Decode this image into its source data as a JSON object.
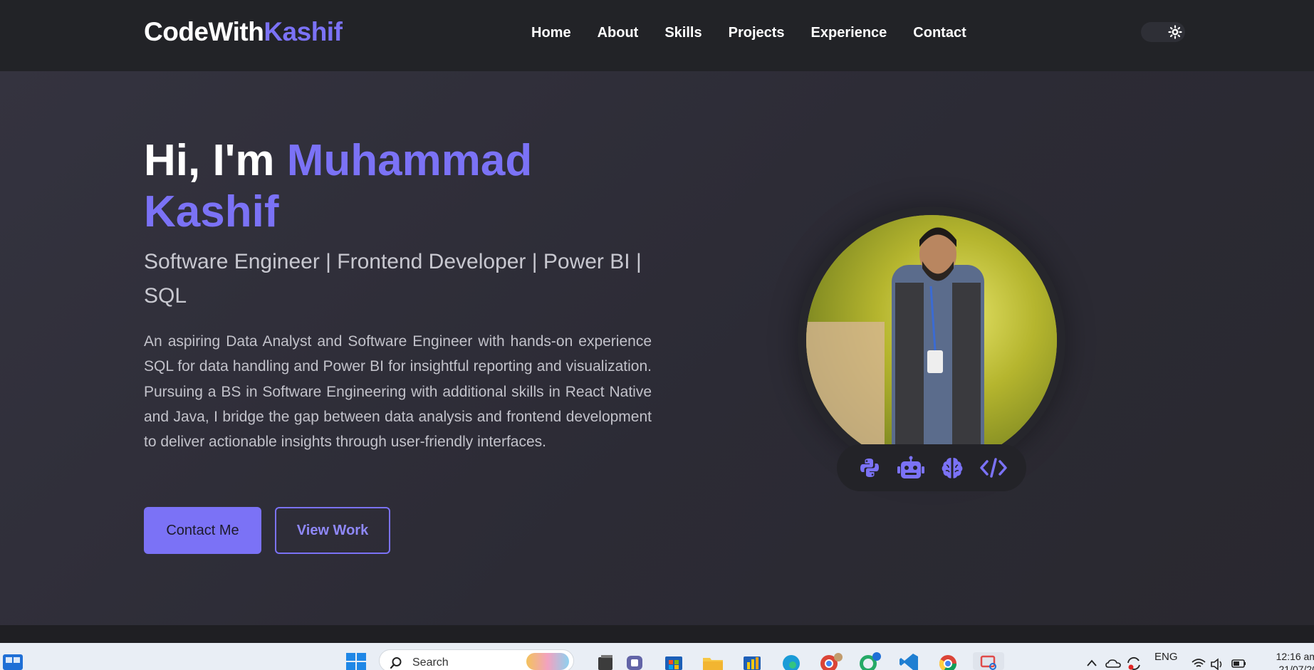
{
  "navbar": {
    "logo_part1": "CodeWith",
    "logo_part2": "Kashif",
    "links": [
      "Home",
      "About",
      "Skills",
      "Projects",
      "Experience",
      "Contact"
    ],
    "theme_toggle_icon": "sun-icon"
  },
  "hero": {
    "greeting": "Hi, I'm ",
    "name": "Muhammad Kashif",
    "subtitle": "Software Engineer | Frontend Developer | Power BI | SQL",
    "about": "An aspiring Data Analyst and Software Engineer with hands-on experience SQL for data handling and Power BI for insightful reporting and visualization. Pursuing a BS in Software Engineering with additional skills in React Native and Java, I bridge the gap between data analysis and frontend development to deliver actionable insights through user-friendly interfaces.",
    "contact_button": "Contact Me",
    "work_button": "View Work"
  },
  "profile": {
    "tech_icons": [
      "python-icon",
      "robot-icon",
      "brain-icon",
      "code-icon"
    ]
  },
  "taskbar": {
    "search_placeholder": "Search",
    "language": "ENG",
    "time": "12:16 am",
    "date": "21/07/20",
    "whatsapp_badge": "7"
  },
  "colors": {
    "accent": "#7b72f6",
    "background": "#2a2a33",
    "navbar": "#222327"
  }
}
